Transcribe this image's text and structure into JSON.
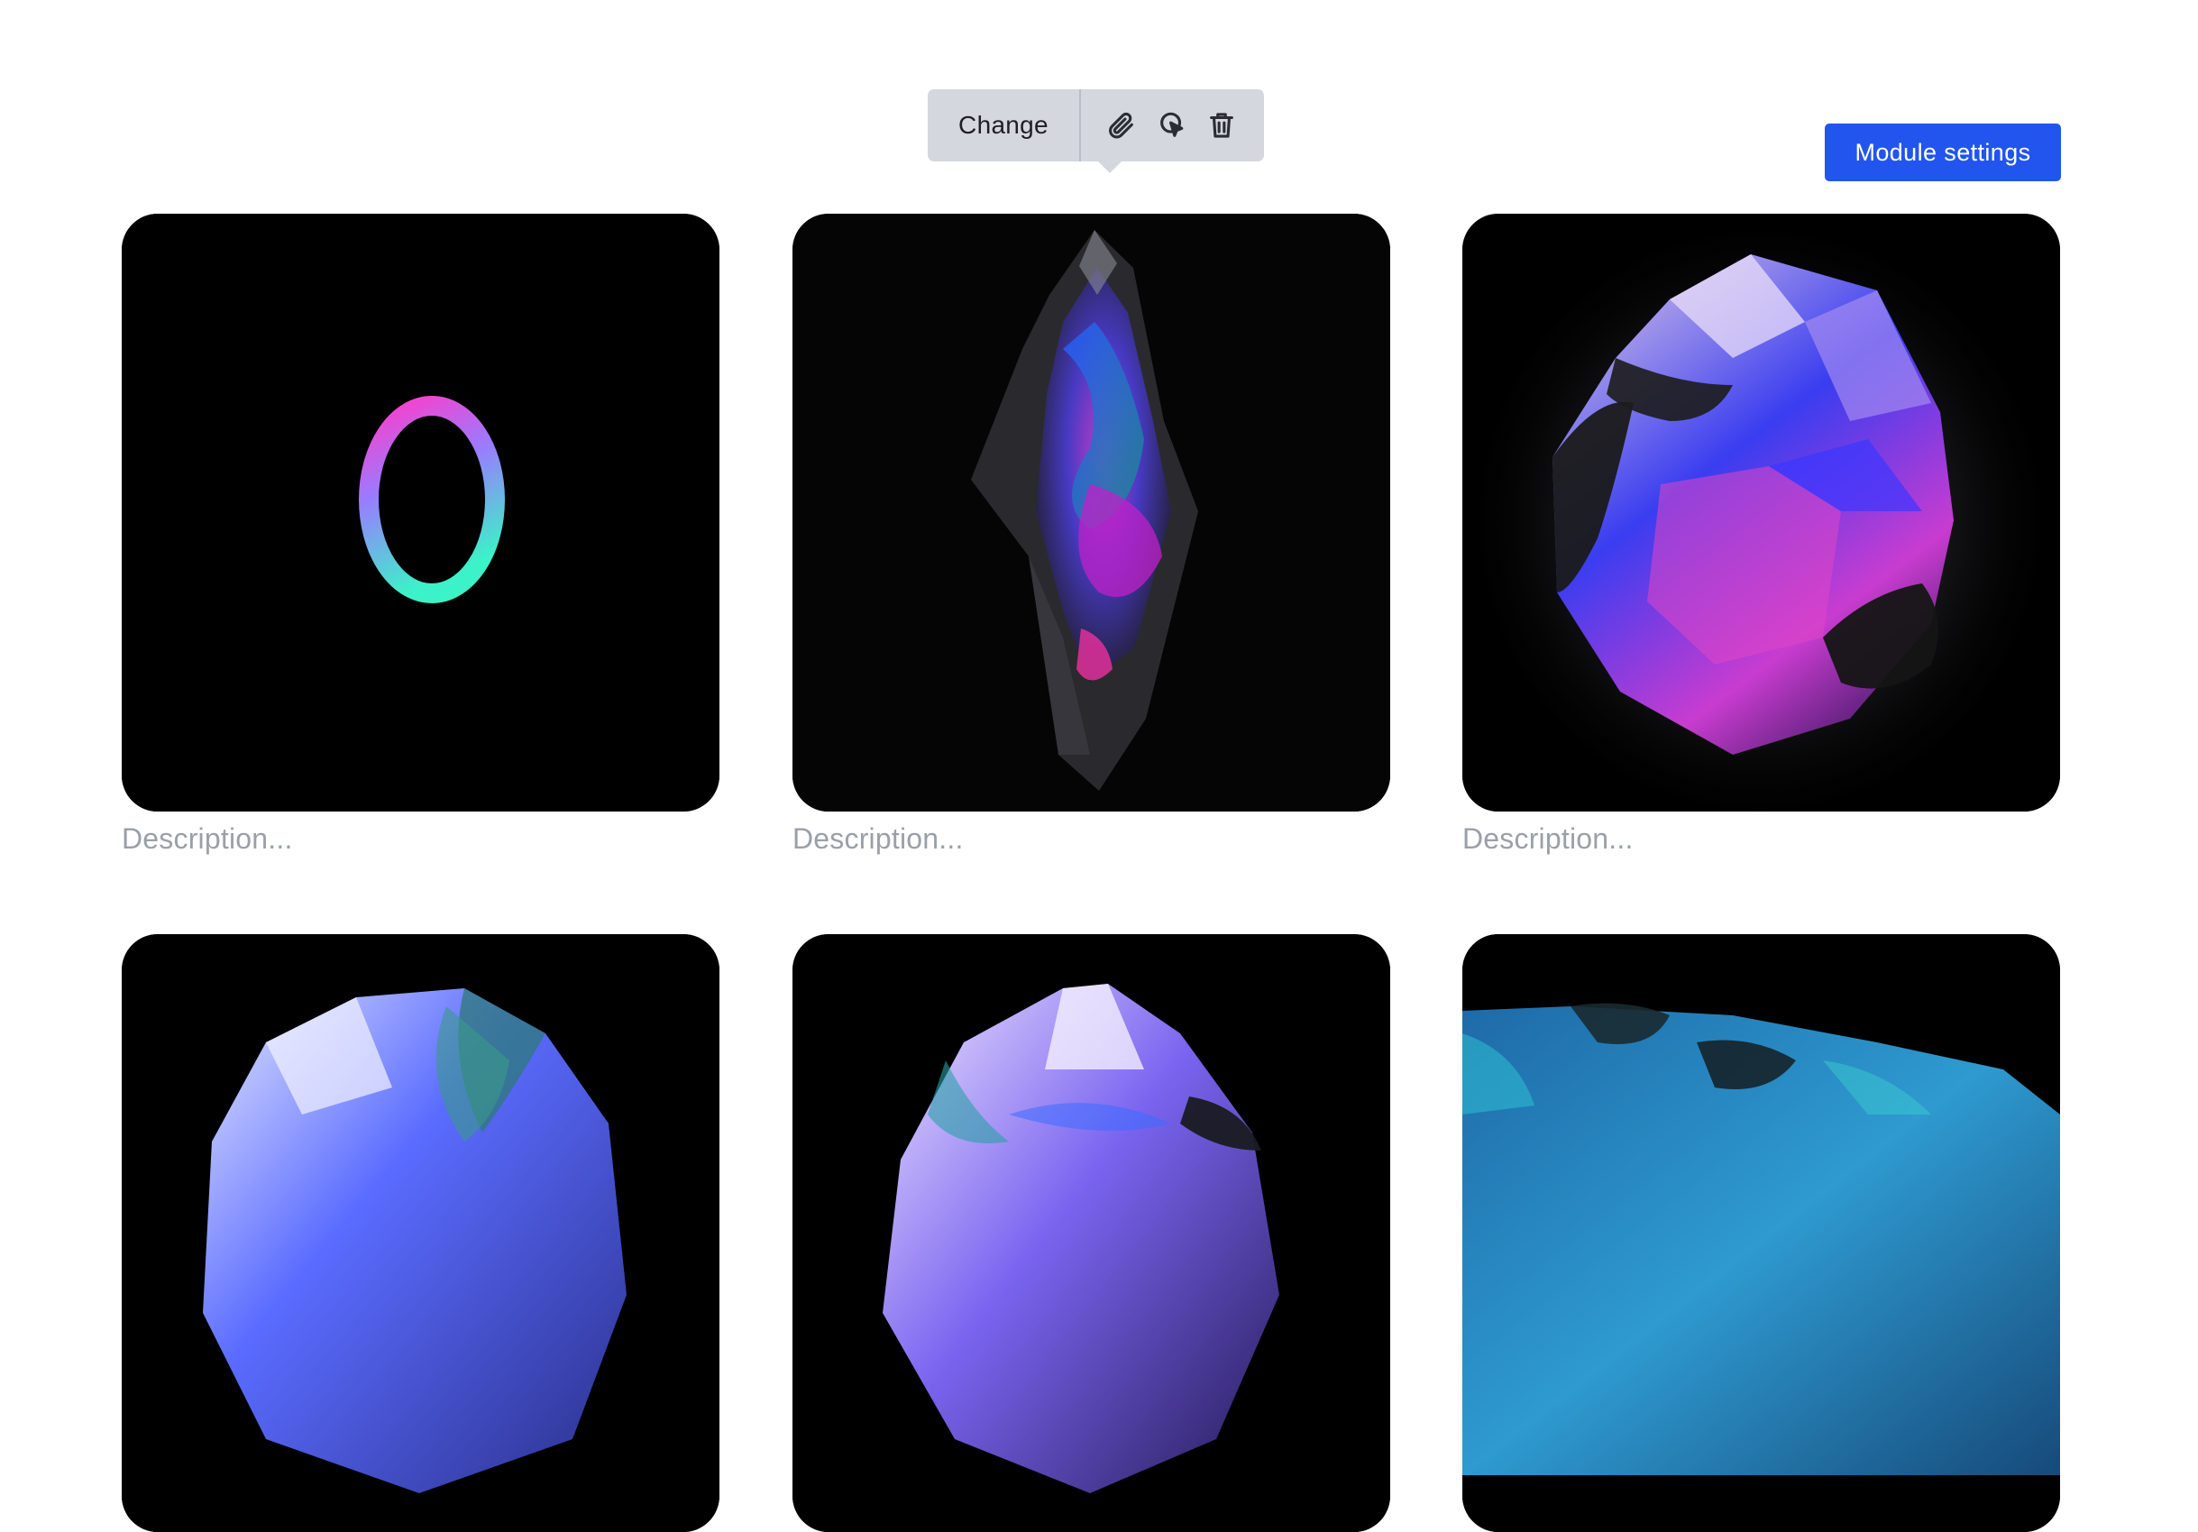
{
  "toolbar": {
    "change_label": "Change",
    "icons": [
      "paperclip-icon",
      "crop-icon",
      "trash-icon"
    ]
  },
  "module_settings": {
    "label": "Module settings",
    "color": "#2255ee"
  },
  "gallery": {
    "items": [
      {
        "image": "neon-ring-image",
        "description_placeholder": "Description..."
      },
      {
        "image": "elongated-crystal-image",
        "description_placeholder": "Description..."
      },
      {
        "image": "faceted-crystal-image",
        "description_placeholder": "Description..."
      },
      {
        "image": "blue-crystal-image",
        "description_placeholder": ""
      },
      {
        "image": "violet-crystal-image",
        "description_placeholder": ""
      },
      {
        "image": "teal-crystal-image",
        "description_placeholder": ""
      }
    ]
  }
}
